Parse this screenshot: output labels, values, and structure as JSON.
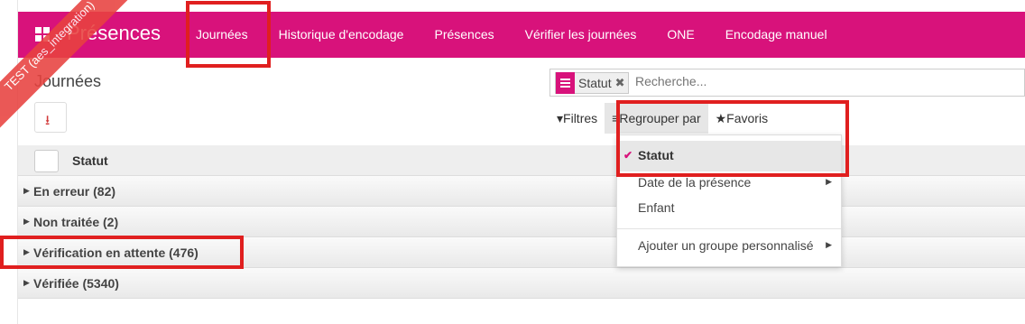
{
  "app": {
    "brand": "Présences",
    "env_ribbon": "TEST (aes_integration)"
  },
  "menu": [
    {
      "label": "Journées"
    },
    {
      "label": "Historique d'encodage"
    },
    {
      "label": "Présences"
    },
    {
      "label": "Vérifier les journées"
    },
    {
      "label": "ONE"
    },
    {
      "label": "Encodage manuel"
    }
  ],
  "page": {
    "title": "Journées",
    "download_icon": "download-icon"
  },
  "search": {
    "facet_label": "Statut",
    "facet_close": "✖",
    "placeholder": "Recherche..."
  },
  "filters": {
    "filtres": "Filtres",
    "regrouper": "Regrouper par",
    "favoris": "Favoris"
  },
  "table": {
    "header": "Statut",
    "groups": [
      {
        "label": "En erreur (82)"
      },
      {
        "label": "Non traitée (2)"
      },
      {
        "label": "Vérification en attente (476)"
      },
      {
        "label": "Vérifiée (5340)"
      }
    ]
  },
  "groupby_menu": {
    "items": [
      {
        "label": "Statut",
        "selected": true
      },
      {
        "label": "Date de la présence"
      },
      {
        "label": "Enfant"
      },
      {
        "label": "Ajouter un groupe personnalisé"
      }
    ]
  },
  "colors": {
    "brand": "#d8127b",
    "highlight": "#e01f1f",
    "ribbon": "#e8423f"
  }
}
